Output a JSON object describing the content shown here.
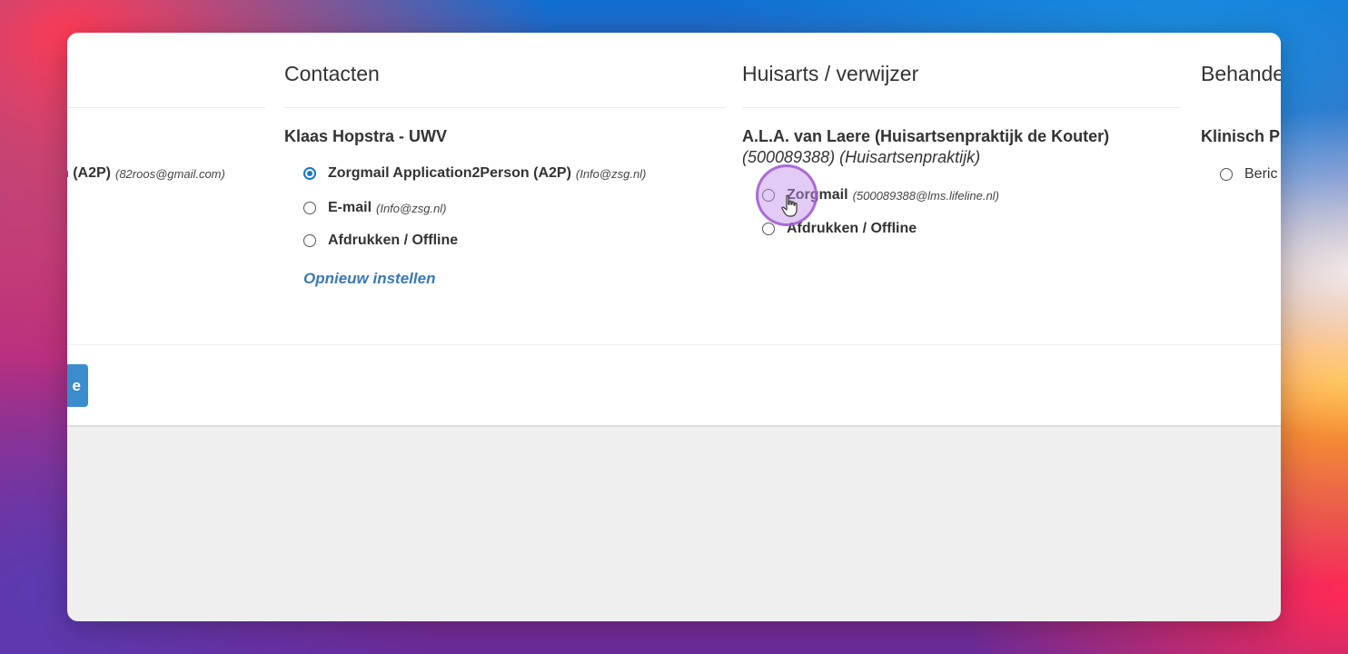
{
  "columns": {
    "first": {
      "option_label": "n (A2P)",
      "option_detail": "(82roos@gmail.com)"
    },
    "contacten": {
      "title": "Contacten",
      "contact_name": "Klaas Hopstra - UWV",
      "options": [
        {
          "label": "Zorgmail Application2Person (A2P)",
          "detail": "(Info@zsg.nl)",
          "checked": true
        },
        {
          "label": "E-mail",
          "detail": "(Info@zsg.nl)",
          "checked": false
        },
        {
          "label": "Afdrukken / Offline",
          "detail": "",
          "checked": false
        }
      ],
      "reset_link": "Opnieuw instellen"
    },
    "huisarts": {
      "title": "Huisarts / verwijzer",
      "contact_name": "A.L.A. van Laere (Huisartsenpraktijk de Kouter)",
      "contact_sub": "(500089388) (Huisartsenpraktijk)",
      "options": [
        {
          "label": "Zorgmail",
          "detail": "(500089388@lms.lifeline.nl)",
          "checked": false
        },
        {
          "label": "Afdrukken / Offline",
          "detail": "",
          "checked": false
        }
      ]
    },
    "behandel": {
      "title": "Behande",
      "contact_name": "Klinisch P",
      "option_label": "Beric"
    }
  },
  "footer": {
    "primary_button_label": "e"
  },
  "colors": {
    "accent": "#1976c8",
    "link": "#3a78b5",
    "button": "#3b8ccc",
    "click_indicator": "#be8ce6"
  },
  "icons": {
    "cursor": "hand-pointer-icon"
  }
}
